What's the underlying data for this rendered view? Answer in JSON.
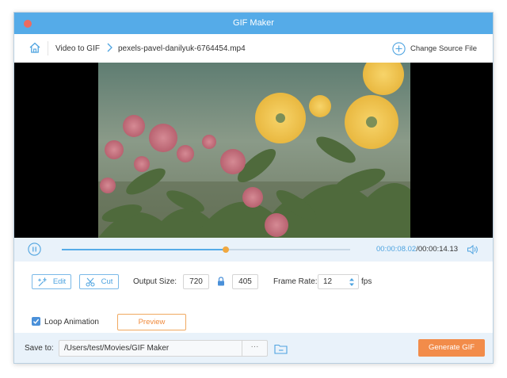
{
  "window": {
    "title": "GIF Maker"
  },
  "breadcrumb": {
    "home_icon": "home-icon",
    "section": "Video to GIF",
    "file": "pexels-pavel-danilyuk-6764454.mp4"
  },
  "header": {
    "change_source_label": "Change Source File",
    "change_source_icon": "plus-circle-icon"
  },
  "player": {
    "progress": 0.5676,
    "current_time": "00:00:08.02",
    "separator": "/",
    "total_time": "00:00:14.13",
    "pause_icon": "pause-icon",
    "volume_icon": "volume-icon"
  },
  "tools": {
    "edit_label": "Edit",
    "cut_label": "Cut"
  },
  "output": {
    "size_label": "Output Size:",
    "width": "720",
    "height": "405",
    "frame_rate_label": "Frame Rate:",
    "frame_rate": "12",
    "fps_unit": "fps"
  },
  "options": {
    "loop_label": "Loop Animation",
    "loop_checked": true,
    "preview_label": "Preview"
  },
  "footer": {
    "save_to_label": "Save to:",
    "path": "/Users/test/Movies/GIF Maker",
    "browse_label": "···",
    "generate_label": "Generate GIF"
  },
  "colors": {
    "accent": "#55abe8",
    "titlebar": "#55abe8",
    "orange": "#f28c4a",
    "thumb": "#f0a840",
    "close": "#ee6b60"
  }
}
